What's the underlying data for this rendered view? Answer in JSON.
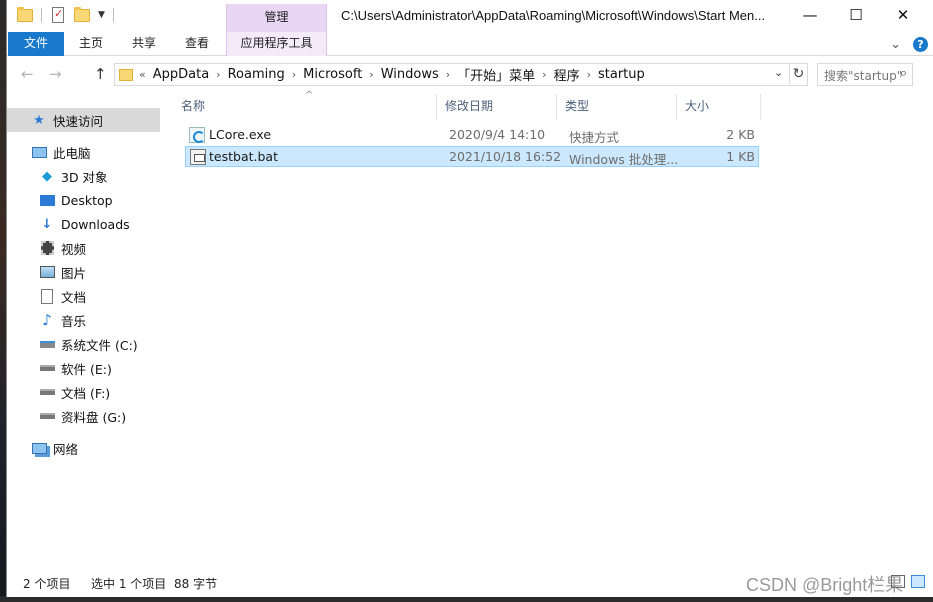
{
  "window": {
    "title_path": "C:\\Users\\Administrator\\AppData\\Roaming\\Microsoft\\Windows\\Start Men...",
    "manage_label": "管理",
    "minimize": "—",
    "maximize": "☐",
    "close": "✕"
  },
  "ribbon": {
    "tabs": [
      "文件",
      "主页",
      "共享",
      "查看",
      "应用程序工具"
    ],
    "help": "?",
    "collapse": "⌄"
  },
  "address": {
    "overflow": "«",
    "crumbs": [
      "AppData",
      "Roaming",
      "Microsoft",
      "Windows",
      "「开始」菜单",
      "程序",
      "startup"
    ],
    "search_placeholder": "搜索\"startup\""
  },
  "sidebar": {
    "items": [
      {
        "label": "快速访问",
        "icon": "star-icon"
      },
      {
        "label": "此电脑",
        "icon": "computer-icon"
      },
      {
        "label": "3D 对象",
        "icon": "3d-objects-icon"
      },
      {
        "label": "Desktop",
        "icon": "desktop-icon"
      },
      {
        "label": "Downloads",
        "icon": "download-icon"
      },
      {
        "label": "视频",
        "icon": "video-icon"
      },
      {
        "label": "图片",
        "icon": "picture-icon"
      },
      {
        "label": "文档",
        "icon": "document-icon"
      },
      {
        "label": "音乐",
        "icon": "music-icon"
      },
      {
        "label": "系统文件 (C:)",
        "icon": "system-drive-icon"
      },
      {
        "label": "软件 (E:)",
        "icon": "drive-icon"
      },
      {
        "label": "文档 (F:)",
        "icon": "drive-icon"
      },
      {
        "label": "资料盘 (G:)",
        "icon": "drive-icon"
      },
      {
        "label": "网络",
        "icon": "network-icon"
      }
    ]
  },
  "columns": {
    "name": "名称",
    "modified": "修改日期",
    "type": "类型",
    "size": "大小"
  },
  "files": [
    {
      "name": "LCore.exe",
      "modified": "2020/9/4 14:10",
      "type": "快捷方式",
      "size": "2 KB",
      "icon": "shortcut-exe-icon"
    },
    {
      "name": "testbat.bat",
      "modified": "2021/10/18 16:52",
      "type": "Windows 批处理...",
      "size": "1 KB",
      "icon": "batch-file-icon"
    }
  ],
  "status": {
    "count": "2 个项目",
    "selected": "选中 1 个项目",
    "size": "88 字节"
  },
  "watermark": "CSDN @Bright栏果"
}
